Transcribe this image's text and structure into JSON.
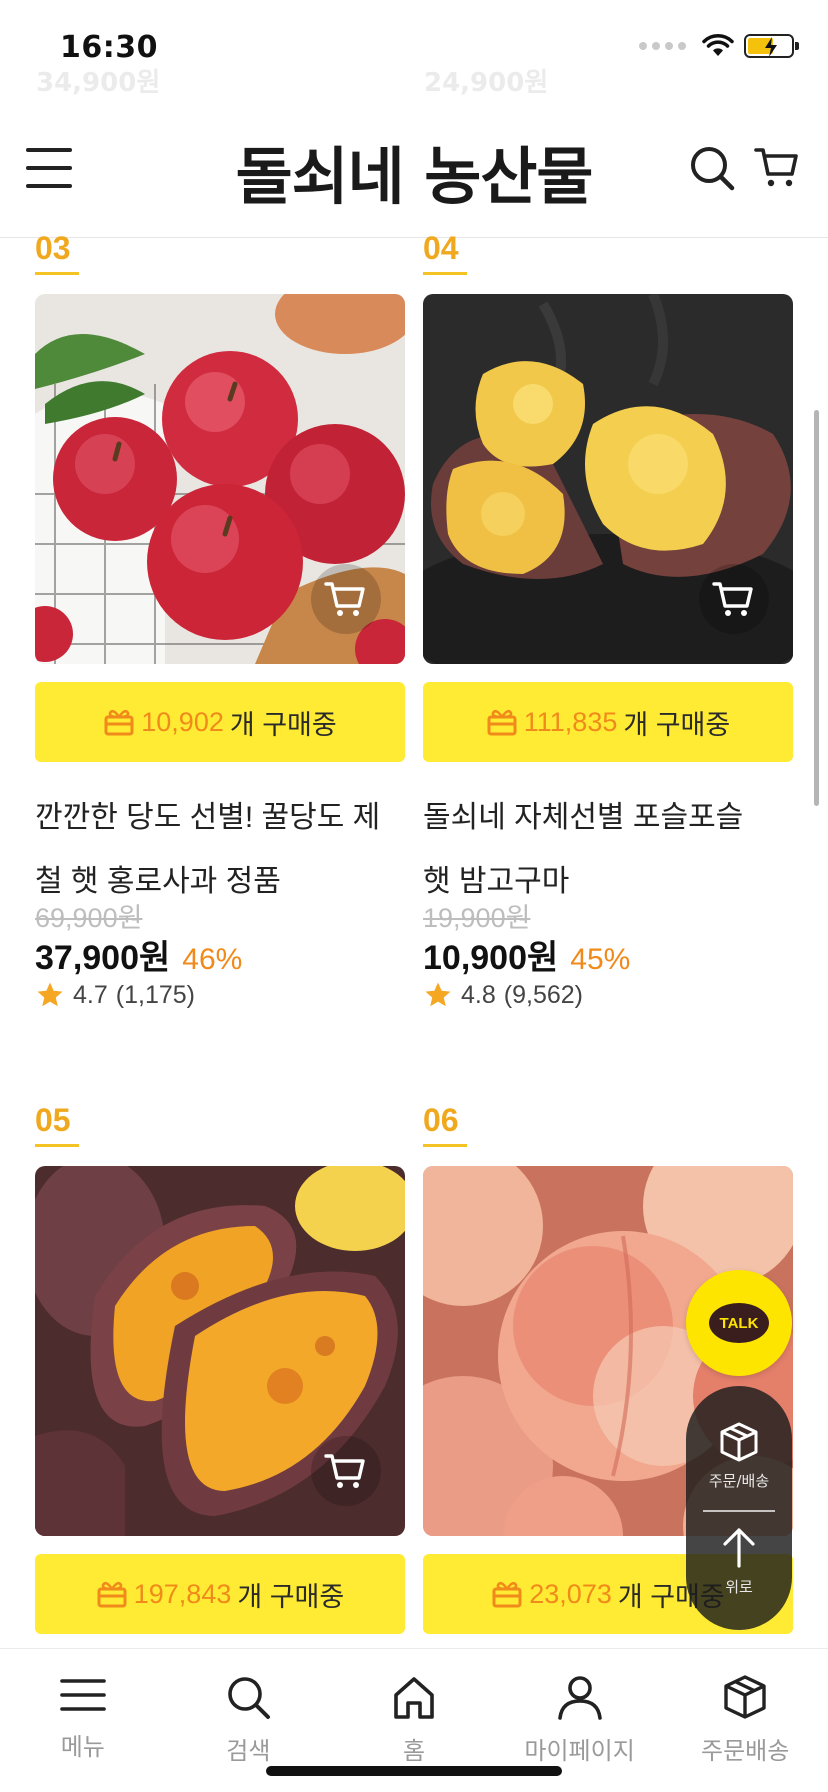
{
  "status_bar": {
    "time": "16:30"
  },
  "ghost_prices": [
    "34,900원",
    "24,900원"
  ],
  "header": {
    "title": "돌쇠네 농산물",
    "menu_icon": "hamburger-icon",
    "search_icon": "search-icon",
    "cart_icon": "cart-icon"
  },
  "products": [
    {
      "rank": "03",
      "buying_count": "10,902",
      "buying_text": "개 구매중",
      "name_line1": "깐깐한 당도 선별! 꿀당도 제",
      "name_line2": "철 햇 홍로사과 정품",
      "original_price": "69,900원",
      "sale_price": "37,900원",
      "discount": "46%",
      "rating": "4.7",
      "reviews": "(1,175)"
    },
    {
      "rank": "04",
      "buying_count": "111,835",
      "buying_text": "개 구매중",
      "name_line1": "돌쇠네 자체선별 포슬포슬",
      "name_line2": "햇 밤고구마",
      "original_price": "19,900원",
      "sale_price": "10,900원",
      "discount": "45%",
      "rating": "4.8",
      "reviews": "(9,562)"
    },
    {
      "rank": "05",
      "buying_count": "197,843",
      "buying_text": "개 구매중"
    },
    {
      "rank": "06",
      "buying_count": "23,073",
      "buying_text": "개 구매중"
    }
  ],
  "floating": {
    "talk": "TALK",
    "order_label": "주문/배송",
    "top_label": "위로"
  },
  "bottom_nav": [
    {
      "label": "메뉴",
      "icon": "hamburger-icon"
    },
    {
      "label": "검색",
      "icon": "search-icon"
    },
    {
      "label": "홈",
      "icon": "home-icon"
    },
    {
      "label": "마이페이지",
      "icon": "user-icon"
    },
    {
      "label": "주문배송",
      "icon": "box-icon"
    }
  ],
  "colors": {
    "accent_yellow": "#ffeb33",
    "rank_orange": "#f0a81f",
    "discount_orange": "#f08a1b",
    "star": "#f5a623"
  }
}
